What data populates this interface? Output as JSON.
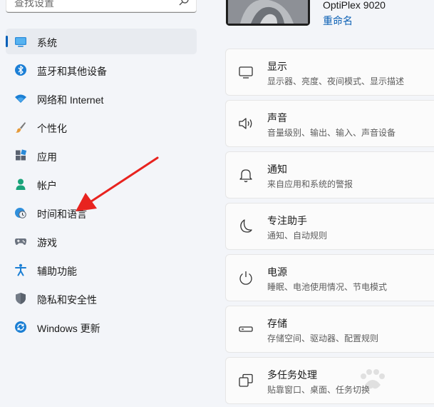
{
  "search": {
    "placeholder": "查找设置"
  },
  "sidebar": {
    "items": [
      {
        "label": "系统",
        "icon": "monitor-icon",
        "active": true
      },
      {
        "label": "蓝牙和其他设备",
        "icon": "bluetooth-icon"
      },
      {
        "label": "网络和 Internet",
        "icon": "wifi-icon"
      },
      {
        "label": "个性化",
        "icon": "brush-icon"
      },
      {
        "label": "应用",
        "icon": "apps-icon"
      },
      {
        "label": "帐户",
        "icon": "person-icon"
      },
      {
        "label": "时间和语言",
        "icon": "clock-globe-icon"
      },
      {
        "label": "游戏",
        "icon": "gamepad-icon"
      },
      {
        "label": "辅助功能",
        "icon": "accessibility-icon"
      },
      {
        "label": "隐私和安全性",
        "icon": "shield-icon"
      },
      {
        "label": "Windows 更新",
        "icon": "update-icon"
      }
    ]
  },
  "device": {
    "name": "OptiPlex 9020",
    "rename": "重命名"
  },
  "cards": [
    {
      "title": "显示",
      "subtitle": "显示器、亮度、夜间模式、显示描述",
      "icon": "display-icon"
    },
    {
      "title": "声音",
      "subtitle": "音量级别、输出、输入、声音设备",
      "icon": "speaker-icon"
    },
    {
      "title": "通知",
      "subtitle": "来自应用和系统的警报",
      "icon": "bell-icon"
    },
    {
      "title": "专注助手",
      "subtitle": "通知、自动规则",
      "icon": "moon-icon"
    },
    {
      "title": "电源",
      "subtitle": "睡眠、电池使用情况、节电模式",
      "icon": "power-icon"
    },
    {
      "title": "存储",
      "subtitle": "存储空间、驱动器、配置规则",
      "icon": "storage-icon"
    },
    {
      "title": "多任务处理",
      "subtitle": "贴靠窗口、桌面、任务切换",
      "icon": "multitask-icon"
    }
  ],
  "colors": {
    "accent": "#005fb8",
    "annotation_arrow": "#e8231f"
  }
}
